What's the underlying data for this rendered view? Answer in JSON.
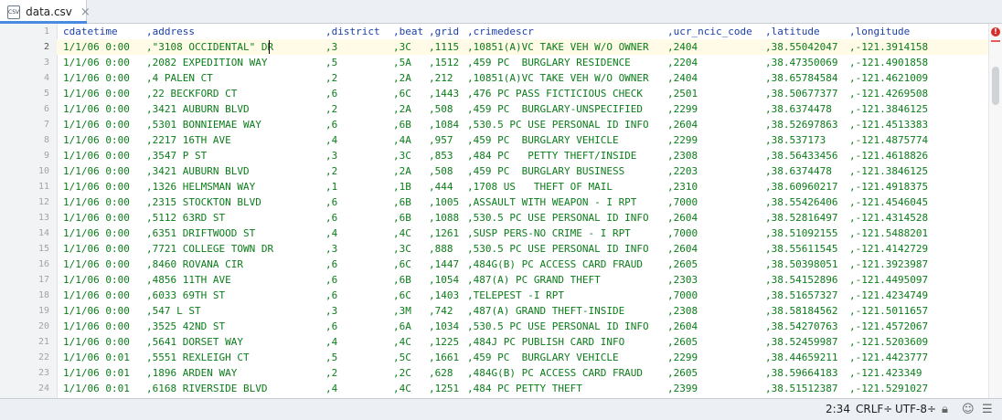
{
  "tab": {
    "filename": "data.csv",
    "icon_label": "CSV"
  },
  "editor": {
    "columns": [
      "datetime",
      "address",
      "district",
      "beat",
      "grid",
      "crimedescr",
      "ucr",
      "lat",
      "lon"
    ],
    "header": {
      "line": "1",
      "cells": [
        "cdatetime",
        ",address",
        ",district",
        ",beat",
        ",grid",
        ",crimedescr",
        ",ucr_ncic_code",
        ",latitude",
        ",longitude"
      ]
    },
    "rows": [
      {
        "line": "2",
        "cells": [
          "1/1/06 0:00",
          ",\"3108 OCCIDENTAL\" DR",
          ",3",
          ",3C",
          ",1115",
          ",10851(A)VC TAKE VEH W/O OWNER",
          ",2404",
          ",38.55042047",
          ",-121.3914158"
        ]
      },
      {
        "line": "3",
        "cells": [
          "1/1/06 0:00",
          ",2082 EXPEDITION WAY",
          ",5",
          ",5A",
          ",1512",
          ",459 PC  BURGLARY RESIDENCE",
          ",2204",
          ",38.47350069",
          ",-121.4901858"
        ]
      },
      {
        "line": "4",
        "cells": [
          "1/1/06 0:00",
          ",4 PALEN CT",
          ",2",
          ",2A",
          ",212",
          ",10851(A)VC TAKE VEH W/O OWNER",
          ",2404",
          ",38.65784584",
          ",-121.4621009"
        ]
      },
      {
        "line": "5",
        "cells": [
          "1/1/06 0:00",
          ",22 BECKFORD CT",
          ",6",
          ",6C",
          ",1443",
          ",476 PC PASS FICTICIOUS CHECK",
          ",2501",
          ",38.50677377",
          ",-121.4269508"
        ]
      },
      {
        "line": "6",
        "cells": [
          "1/1/06 0:00",
          ",3421 AUBURN BLVD",
          ",2",
          ",2A",
          ",508",
          ",459 PC  BURGLARY-UNSPECIFIED",
          ",2299",
          ",38.6374478",
          ",-121.3846125"
        ]
      },
      {
        "line": "7",
        "cells": [
          "1/1/06 0:00",
          ",5301 BONNIEMAE WAY",
          ",6",
          ",6B",
          ",1084",
          ",530.5 PC USE PERSONAL ID INFO",
          ",2604",
          ",38.52697863",
          ",-121.4513383"
        ]
      },
      {
        "line": "8",
        "cells": [
          "1/1/06 0:00",
          ",2217 16TH AVE",
          ",4",
          ",4A",
          ",957",
          ",459 PC  BURGLARY VEHICLE",
          ",2299",
          ",38.537173",
          ",-121.4875774"
        ]
      },
      {
        "line": "9",
        "cells": [
          "1/1/06 0:00",
          ",3547 P ST",
          ",3",
          ",3C",
          ",853",
          ",484 PC   PETTY THEFT/INSIDE",
          ",2308",
          ",38.56433456",
          ",-121.4618826"
        ]
      },
      {
        "line": "10",
        "cells": [
          "1/1/06 0:00",
          ",3421 AUBURN BLVD",
          ",2",
          ",2A",
          ",508",
          ",459 PC  BURGLARY BUSINESS",
          ",2203",
          ",38.6374478",
          ",-121.3846125"
        ]
      },
      {
        "line": "11",
        "cells": [
          "1/1/06 0:00",
          ",1326 HELMSMAN WAY",
          ",1",
          ",1B",
          ",444",
          ",1708 US   THEFT OF MAIL",
          ",2310",
          ",38.60960217",
          ",-121.4918375"
        ]
      },
      {
        "line": "12",
        "cells": [
          "1/1/06 0:00",
          ",2315 STOCKTON BLVD",
          ",6",
          ",6B",
          ",1005",
          ",ASSAULT WITH WEAPON - I RPT",
          ",7000",
          ",38.55426406",
          ",-121.4546045"
        ]
      },
      {
        "line": "13",
        "cells": [
          "1/1/06 0:00",
          ",5112 63RD ST",
          ",6",
          ",6B",
          ",1088",
          ",530.5 PC USE PERSONAL ID INFO",
          ",2604",
          ",38.52816497",
          ",-121.4314528"
        ]
      },
      {
        "line": "14",
        "cells": [
          "1/1/06 0:00",
          ",6351 DRIFTWOOD ST",
          ",4",
          ",4C",
          ",1261",
          ",SUSP PERS-NO CRIME - I RPT",
          ",7000",
          ",38.51092155",
          ",-121.5488201"
        ]
      },
      {
        "line": "15",
        "cells": [
          "1/1/06 0:00",
          ",7721 COLLEGE TOWN DR",
          ",3",
          ",3C",
          ",888",
          ",530.5 PC USE PERSONAL ID INFO",
          ",2604",
          ",38.55611545",
          ",-121.4142729"
        ]
      },
      {
        "line": "16",
        "cells": [
          "1/1/06 0:00",
          ",8460 ROVANA CIR",
          ",6",
          ",6C",
          ",1447",
          ",484G(B) PC ACCESS CARD FRAUD",
          ",2605",
          ",38.50398051",
          ",-121.3923987"
        ]
      },
      {
        "line": "17",
        "cells": [
          "1/1/06 0:00",
          ",4856 11TH AVE",
          ",6",
          ",6B",
          ",1054",
          ",487(A) PC GRAND THEFT",
          ",2303",
          ",38.54152896",
          ",-121.4495097"
        ]
      },
      {
        "line": "18",
        "cells": [
          "1/1/06 0:00",
          ",6033 69TH ST",
          ",6",
          ",6C",
          ",1403",
          ",TELEPEST -I RPT",
          ",7000",
          ",38.51657327",
          ",-121.4234749"
        ]
      },
      {
        "line": "19",
        "cells": [
          "1/1/06 0:00",
          ",547 L ST",
          ",3",
          ",3M",
          ",742",
          ",487(A) GRAND THEFT-INSIDE",
          ",2308",
          ",38.58184562",
          ",-121.5011657"
        ]
      },
      {
        "line": "20",
        "cells": [
          "1/1/06 0:00",
          ",3525 42ND ST",
          ",6",
          ",6A",
          ",1034",
          ",530.5 PC USE PERSONAL ID INFO",
          ",2604",
          ",38.54270763",
          ",-121.4572067"
        ]
      },
      {
        "line": "21",
        "cells": [
          "1/1/06 0:00",
          ",5641 DORSET WAY",
          ",4",
          ",4C",
          ",1225",
          ",484J PC PUBLISH CARD INFO",
          ",2605",
          ",38.52459987",
          ",-121.5203609"
        ]
      },
      {
        "line": "22",
        "cells": [
          "1/1/06 0:01",
          ",5551 REXLEIGH CT",
          ",5",
          ",5C",
          ",1661",
          ",459 PC  BURGLARY VEHICLE",
          ",2299",
          ",38.44659211",
          ",-121.4423777"
        ]
      },
      {
        "line": "23",
        "cells": [
          "1/1/06 0:01",
          ",1896 ARDEN WAY",
          ",2",
          ",2C",
          ",628",
          ",484G(B) PC ACCESS CARD FRAUD",
          ",2605",
          ",38.59664183",
          ",-121.423349"
        ]
      },
      {
        "line": "24",
        "cells": [
          "1/1/06 0:01",
          ",6168 RIVERSIDE BLVD",
          ",4",
          ",4C",
          ",1251",
          ",484 PC PETTY THEFT",
          ",2399",
          ",38.51512387",
          ",-121.5291027"
        ]
      }
    ],
    "current_line": "2"
  },
  "statusbar": {
    "position": "2:34",
    "line_ending": "CRLF÷",
    "encoding": "UTF-8÷"
  },
  "icons": {
    "error": "error-icon",
    "lock": "lock-icon",
    "inspector": "inspector-icon",
    "notifications": "notifications-icon"
  },
  "colors": {
    "value_text": "#0b7d1a",
    "header_text": "#1c3fa7",
    "current_line_bg": "#fffbe6",
    "error": "#d32f2f"
  }
}
